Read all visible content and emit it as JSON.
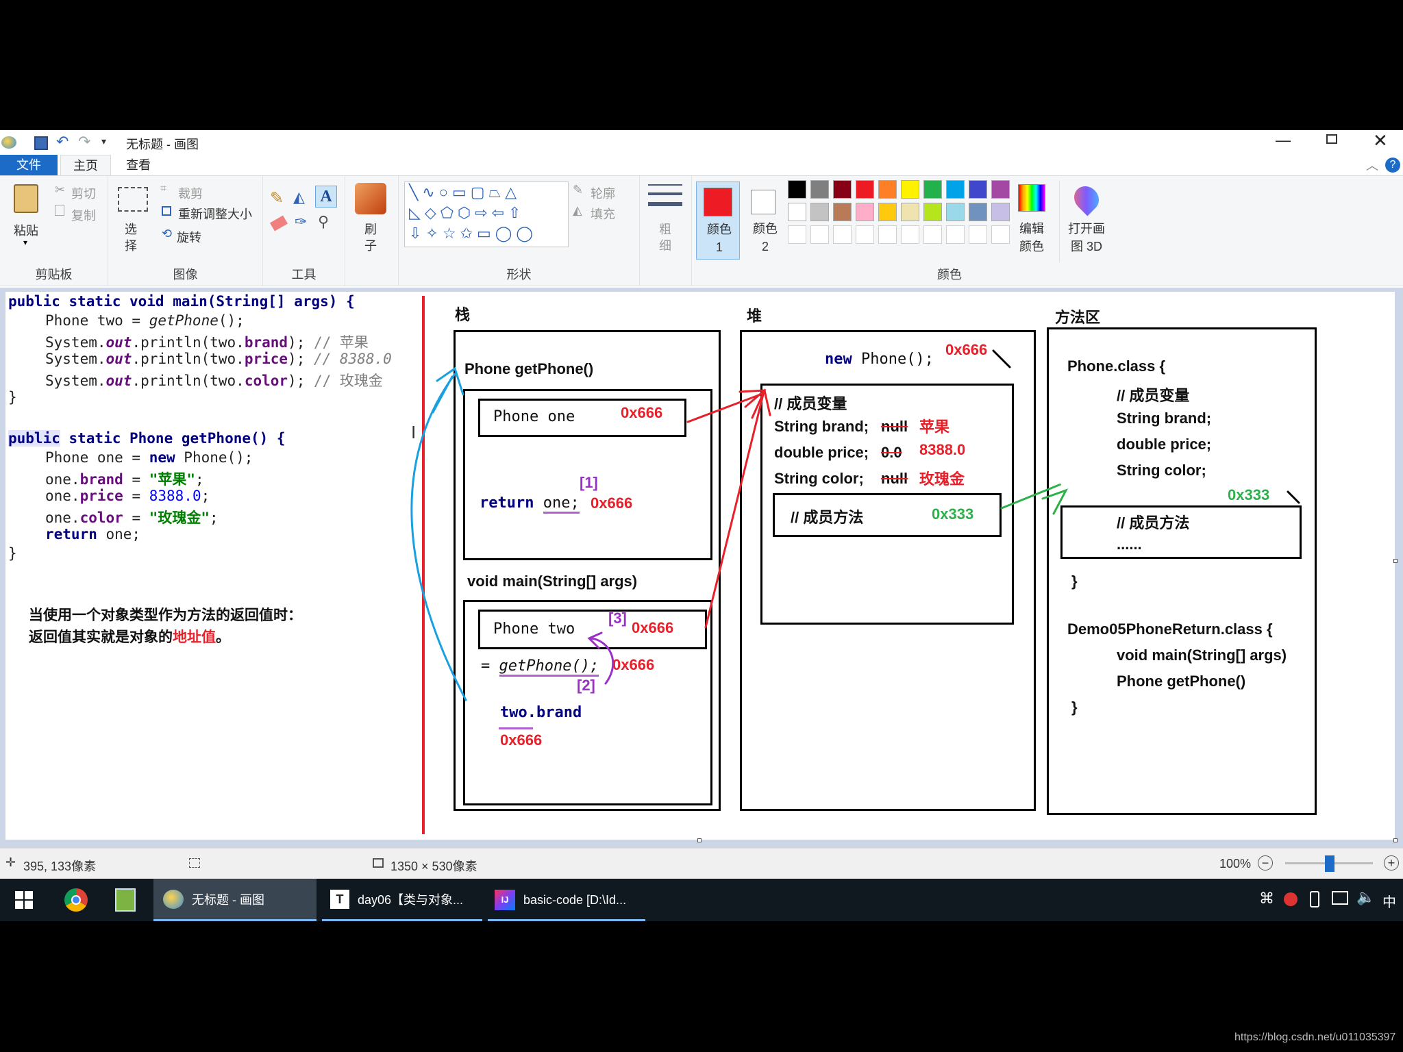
{
  "window": {
    "title": "无标题 - 画图",
    "tabs": [
      "文件",
      "主页",
      "查看"
    ]
  },
  "ribbon": {
    "clipboard": {
      "label": "剪贴板",
      "paste": "粘贴",
      "cut": "剪切",
      "copy": "复制"
    },
    "image": {
      "label": "图像",
      "select": "选择",
      "crop": "裁剪",
      "resize": "重新调整大小",
      "rotate": "旋转"
    },
    "tools": {
      "label": "工具"
    },
    "brush": {
      "label": "刷子"
    },
    "shapes": {
      "label": "形状",
      "outline": "轮廓",
      "fill": "填充"
    },
    "size": {
      "label": "粗细"
    },
    "color1": {
      "label": "颜色 1",
      "value": "#ed1c24"
    },
    "color2": {
      "label": "颜色 2",
      "value": "#ffffff"
    },
    "colors": {
      "label": "颜色",
      "row1": [
        "#000000",
        "#7f7f7f",
        "#880015",
        "#ed1c24",
        "#ff7f27",
        "#fff200",
        "#22b14c",
        "#00a2e8",
        "#3f48cc",
        "#a349a4"
      ],
      "row2": [
        "#ffffff",
        "#c3c3c3",
        "#b97a57",
        "#ffaec9",
        "#ffc90e",
        "#efe4b0",
        "#b5e61d",
        "#99d9ea",
        "#7092be",
        "#c8bfe7"
      ]
    },
    "edit_colors": "编辑颜色",
    "paint3d": "打开画图 3D"
  },
  "code": {
    "main_sig": "public static void main(String[] args) {",
    "line1_a": "Phone two = ",
    "line1_b": "getPhone",
    "line1_c": "();",
    "sys": "System.",
    "out": "out",
    "println_brand": ".println(two.",
    "brand": "brand",
    "tail": "); ",
    "cmt_brand": "// 苹果",
    "price": "price",
    "cmt_price": "// 8388.0",
    "color": "color",
    "cmt_color": "// 玫瑰金",
    "close": "}",
    "get_sig_a": "public",
    "get_sig_b": " static Phone getPhone() {",
    "one_new_a": "Phone one = ",
    "one_new_b": "new",
    "one_new_c": " Phone();",
    "one_dot": "one.",
    "eq": " = ",
    "str_brand": "\"苹果\"",
    "semi": ";",
    "num_price": "8388.0",
    "str_color": "\"玫瑰金\"",
    "ret_kw": "return",
    "ret_rest": " one;"
  },
  "note": {
    "line1": "当使用一个对象类型作为方法的返回值时：",
    "line2_a": "返回值其实就是对象的",
    "line2_b": "地址值",
    "line2_c": "。"
  },
  "diagram": {
    "stack_title": "栈",
    "heap_title": "堆",
    "method_title": "方法区",
    "getphone_frame": "Phone getPhone()",
    "phone_one": "Phone one",
    "addr": "0x666",
    "marker1": "[1]",
    "marker2": "[2]",
    "marker3": "[3]",
    "return_kw": "return",
    "return_var": "one;",
    "main_frame": "void main(String[] args)",
    "phone_two": "Phone two",
    "eq_getphone": "getPhone();",
    "eq_sign": "=",
    "two_brand": "two.brand",
    "new_kw": "new",
    "new_rest": "Phone();",
    "member_vars": "// 成员变量",
    "f_brand": "String brand;",
    "f_price": "double price;",
    "f_color": "String color;",
    "null_a": "null",
    "zero": "0.0",
    "v_brand": "苹果",
    "v_price": "8388.0",
    "v_color": "玫瑰金",
    "member_methods": "// 成员方法",
    "method_addr": "0x333",
    "phone_class": "Phone.class {",
    "dots": "......",
    "close_brace": "}",
    "demo_class": "Demo05PhoneReturn.class {",
    "demo_main": "void main(String[] args)",
    "demo_get": "Phone getPhone()"
  },
  "status": {
    "cursor_pos": "395, 133像素",
    "canvas_size": "1350 × 530像素",
    "zoom": "100%"
  },
  "taskbar": {
    "paint": "无标题 - 画图",
    "typora": "day06【类与对象...",
    "idea": "basic-code [D:\\Id...",
    "ime": "中"
  },
  "watermark": "https://blog.csdn.net/u011035397"
}
